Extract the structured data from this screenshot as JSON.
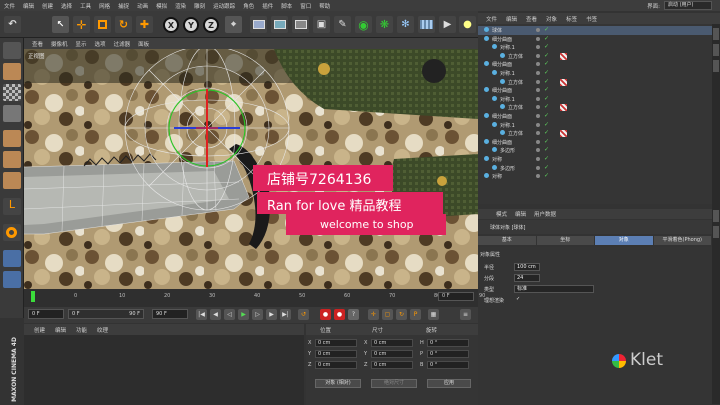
{
  "menubar": {
    "items": [
      "文件",
      "编辑",
      "创建",
      "选择",
      "工具",
      "网格",
      "捕捉",
      "动画",
      "模拟",
      "渲染",
      "雕刻",
      "运动跟踪",
      "角色",
      "插件",
      "脚本",
      "窗口",
      "帮助"
    ],
    "layout_label": "界面:",
    "layout_value": "启动 (用户)"
  },
  "viewport": {
    "menu": [
      "查看",
      "摄像机",
      "显示",
      "选项",
      "过滤器",
      "面板"
    ],
    "label": "正视图"
  },
  "object_manager": {
    "tabs": [
      "文件",
      "编辑",
      "查看",
      "对象",
      "标签",
      "书签"
    ],
    "rows": [
      {
        "name": "球体",
        "indent": 14,
        "selected": true
      },
      {
        "name": "细分曲面",
        "indent": 14
      },
      {
        "name": "对称.1",
        "indent": 22
      },
      {
        "name": "立方体",
        "indent": 30,
        "tag": true
      },
      {
        "name": "细分曲面",
        "indent": 14
      },
      {
        "name": "对称.1",
        "indent": 22
      },
      {
        "name": "立方体",
        "indent": 30,
        "tag": true
      },
      {
        "name": "细分曲面",
        "indent": 14
      },
      {
        "name": "对称.1",
        "indent": 22
      },
      {
        "name": "立方体",
        "indent": 30,
        "tag": true
      },
      {
        "name": "细分曲面",
        "indent": 14
      },
      {
        "name": "对称.1",
        "indent": 22
      },
      {
        "name": "立方体",
        "indent": 30,
        "tag": true
      },
      {
        "name": "细分曲面",
        "indent": 14
      },
      {
        "name": "多边形",
        "indent": 22
      },
      {
        "name": "对称",
        "indent": 14
      },
      {
        "name": "多边形",
        "indent": 22
      },
      {
        "name": "对称",
        "indent": 14
      }
    ]
  },
  "attributes": {
    "tabs": [
      "模式",
      "编辑",
      "用户数据"
    ],
    "title": "球体对象 [球体]",
    "subtabs": [
      "基本",
      "坐标",
      "对象",
      "平滑着色(Phong)"
    ],
    "active_subtab": 2,
    "section": "对象属性",
    "fields": [
      {
        "label": "半径",
        "value": "100 cm"
      },
      {
        "label": "分段",
        "value": "24"
      },
      {
        "label": "类型",
        "value": "标准"
      },
      {
        "label": "理想渲染",
        "value": "✓"
      }
    ]
  },
  "timeline": {
    "ticks": [
      "0",
      "10",
      "20",
      "30",
      "40",
      "50",
      "60",
      "70",
      "80",
      "90"
    ],
    "end_field": "0 F",
    "start": "0 F",
    "current": "0 F",
    "max": "90 F",
    "end": "90 F"
  },
  "material": {
    "menu": [
      "创建",
      "编辑",
      "功能",
      "纹理"
    ]
  },
  "coords": {
    "headers": [
      "位置",
      "尺寸",
      "旋转"
    ],
    "axes": [
      "X",
      "Y",
      "Z"
    ],
    "pos": [
      "0 cm",
      "0 cm",
      "0 cm"
    ],
    "size": [
      "0 cm",
      "0 cm",
      "0 cm"
    ],
    "rot_labels": [
      "H",
      "P",
      "B"
    ],
    "rot": [
      "0 °",
      "0 °",
      "0 °"
    ],
    "mode": "对象 (相对)",
    "size_mode": "绝对尺寸",
    "apply": "应用"
  },
  "watermark": {
    "line1": "店铺号7264136",
    "line2": "Ran for love 精品教程",
    "line3": "welcome to shop"
  },
  "brand": {
    "maxon": "MAXON CINEMA 4D",
    "klet": "Klet"
  }
}
